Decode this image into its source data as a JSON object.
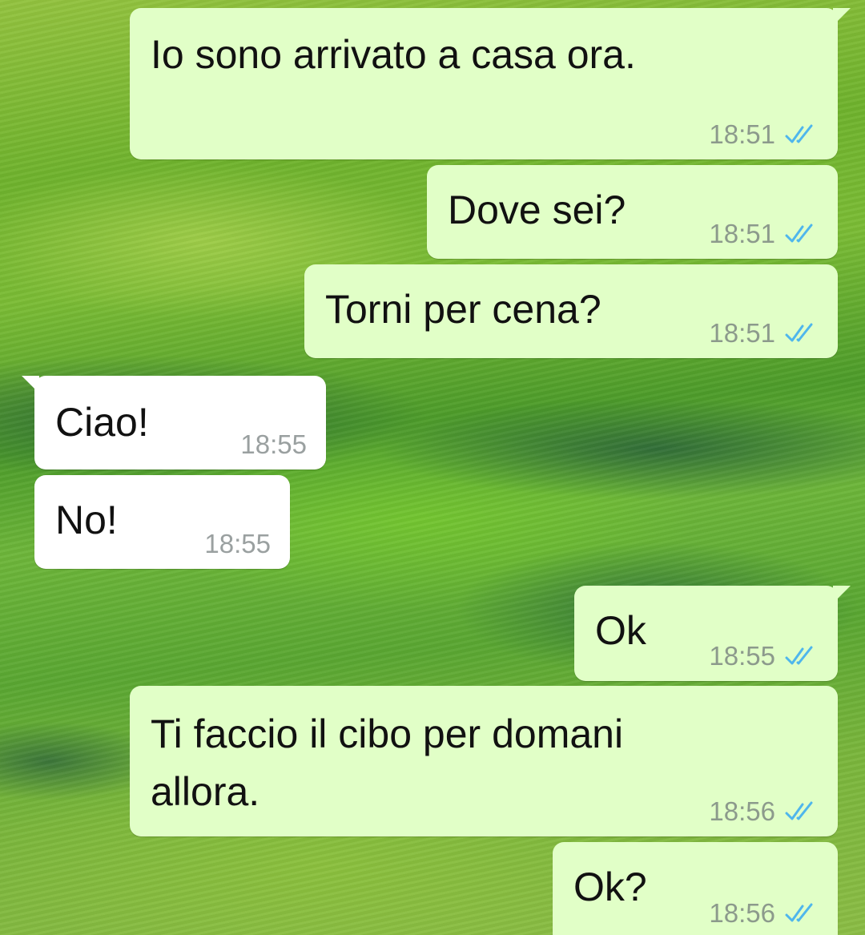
{
  "chat": {
    "messages": [
      {
        "direction": "outgoing",
        "text": "Io sono arrivato a casa ora.",
        "time": "18:51",
        "status_icon": "double-check-read-icon"
      },
      {
        "direction": "outgoing",
        "text": "Dove sei?",
        "time": "18:51",
        "status_icon": "double-check-read-icon"
      },
      {
        "direction": "outgoing",
        "text": "Torni per cena?",
        "time": "18:51",
        "status_icon": "double-check-read-icon"
      },
      {
        "direction": "incoming",
        "text": "Ciao!",
        "time": "18:55"
      },
      {
        "direction": "incoming",
        "text": "No!",
        "time": "18:55"
      },
      {
        "direction": "outgoing",
        "text": "Ok",
        "time": "18:55",
        "status_icon": "double-check-read-icon"
      },
      {
        "direction": "outgoing",
        "text": "Ti faccio il cibo per domani\nallora.",
        "time": "18:56",
        "status_icon": "double-check-read-icon"
      },
      {
        "direction": "outgoing",
        "text": "Ok?",
        "time": "18:56",
        "status_icon": "double-check-read-icon"
      }
    ]
  },
  "colors": {
    "outgoing_bubble": "#e1ffc7",
    "incoming_bubble": "#ffffff",
    "read_ticks": "#4fb6ec"
  }
}
